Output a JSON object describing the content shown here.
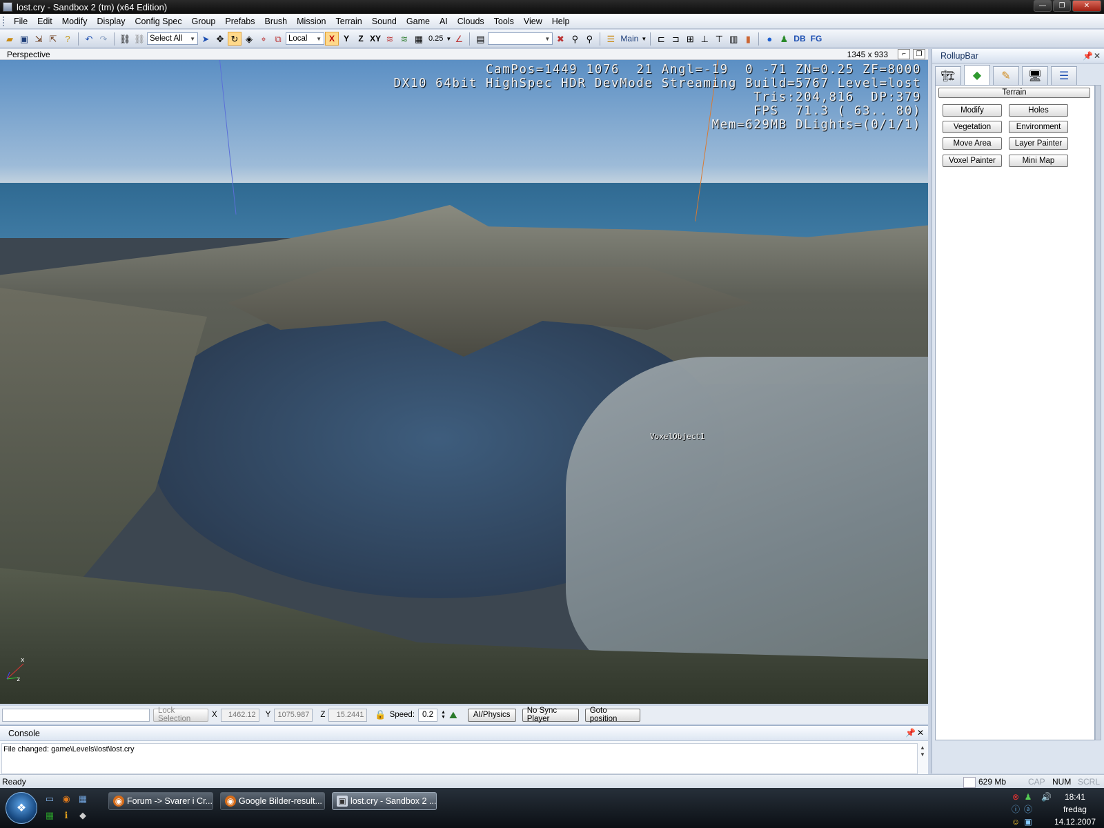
{
  "window": {
    "title": "lost.cry - Sandbox 2 (tm) (x64 Edition)",
    "controls": {
      "minimize": "—",
      "maximize": "❐",
      "close": "✕"
    }
  },
  "menu": [
    "File",
    "Edit",
    "Modify",
    "Display",
    "Config Spec",
    "Group",
    "Prefabs",
    "Brush",
    "Mission",
    "Terrain",
    "Sound",
    "Game",
    "AI",
    "Clouds",
    "Tools",
    "View",
    "Help"
  ],
  "toolbar": {
    "selection_combo": "Select All",
    "coord_combo": "Local",
    "axis_x": "X",
    "axis_y": "Y",
    "axis_z": "Z",
    "axis_xy": "XY",
    "grid_value": "0.25",
    "layer_label": "Main",
    "db_label": "DB",
    "fg_label": "FG"
  },
  "viewport": {
    "title": "Perspective",
    "size": "1345 x 933",
    "hud": "CamPos=1449 1076  21 Angl=-19  0 -71 ZN=0.25 ZF=8000\nDX10 64bit HighSpec HDR DevMode Streaming Build=5767 Level=lost\nTris:204,816  DP:379\nFPS  71.3 ( 63.. 80)\nMem=629MB DLights=(0/1/1)",
    "object_label": "VoxelObject1",
    "gizmo_x": "x",
    "gizmo_z": "z"
  },
  "statusrow": {
    "lock_selection": "Lock Selection",
    "x_label": "X",
    "x_value": "1462.12",
    "y_label": "Y",
    "y_value": "1075.987",
    "z_label": "Z",
    "z_value": "15.2441",
    "speed_label": "Speed:",
    "speed_value": "0.2",
    "ai_physics": "AI/Physics",
    "no_sync": "No Sync Player",
    "goto": "Goto position"
  },
  "console": {
    "title": "Console",
    "line": "File changed: game\\Levels\\lost\\lost.cry"
  },
  "statusbar": {
    "ready": "Ready",
    "memory": "629 Mb",
    "cap": "CAP",
    "num": "NUM",
    "scrl": "SCRL"
  },
  "rollup": {
    "title": "RollupBar",
    "section": "Terrain",
    "buttons": [
      "Modify",
      "Holes",
      "Vegetation",
      "Environment",
      "Move Area",
      "Layer Painter",
      "Voxel Painter",
      "Mini Map"
    ]
  },
  "taskbar": {
    "tasks": [
      "Forum -> Svarer i Cr...",
      "Google Bilder-result...",
      "lost.cry - Sandbox 2 ..."
    ],
    "time": "18:41",
    "day": "fredag",
    "date": "14.12.2007"
  }
}
